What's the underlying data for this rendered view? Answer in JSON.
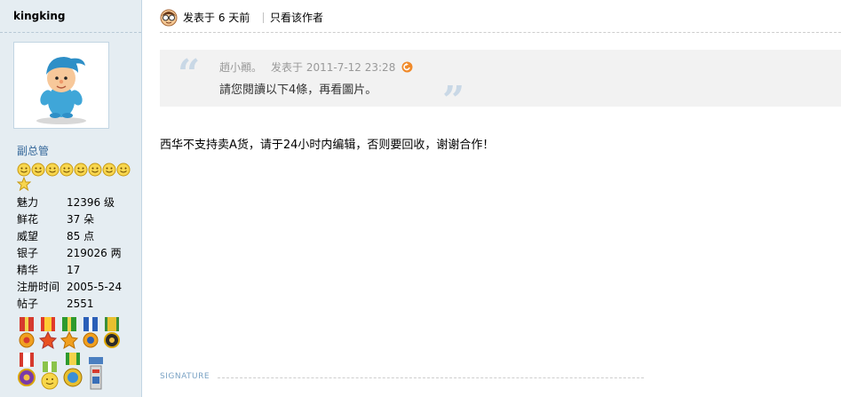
{
  "user": {
    "name": "kingking",
    "group": "副总管",
    "stats": [
      {
        "label": "魅力",
        "value": "12396 级"
      },
      {
        "label": "鲜花",
        "value": "37 朵"
      },
      {
        "label": "威望",
        "value": "85 点"
      },
      {
        "label": "银子",
        "value": "219026 两"
      },
      {
        "label": "精华",
        "value": "17"
      },
      {
        "label": "注册时间",
        "value": "2005-5-24"
      },
      {
        "label": "帖子",
        "value": "2551"
      }
    ]
  },
  "post": {
    "posted_label": "发表于 6 天前",
    "only_author_label": "只看该作者",
    "quote": {
      "author": "趙小顚。",
      "posted": "发表于 2011-7-12 23:28",
      "text": "請您閱讀以下4條，再看圖片。"
    },
    "message": "西华不支持卖A货，请于24小时内编辑，否则要回收，谢谢合作！",
    "signature_label": "SIGNATURE"
  },
  "colors": {
    "sidebar_bg": "#e5edf2",
    "quote_bg": "#f2f2f2",
    "group_link": "#336699",
    "quote_meta": "#999999"
  }
}
